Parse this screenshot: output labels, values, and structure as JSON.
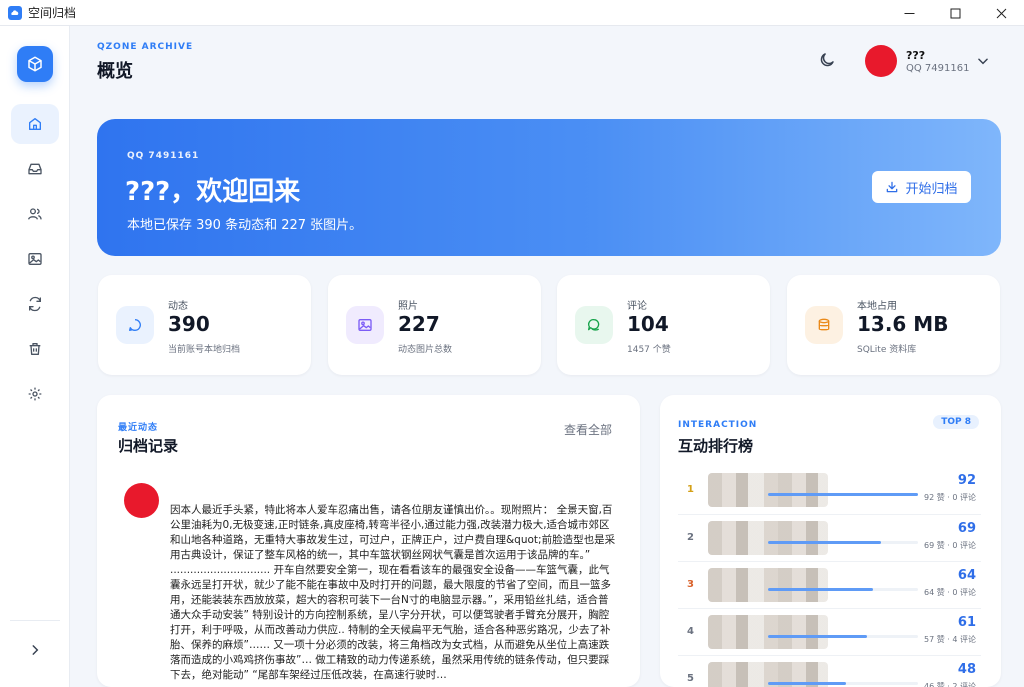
{
  "window": {
    "title": "空间归档"
  },
  "header": {
    "eyebrow": "QZONE ARCHIVE",
    "title": "概览",
    "user_name": "???",
    "user_id": "QQ 7491161"
  },
  "hero": {
    "account": "QQ 7491161",
    "greeting": "???，欢迎回来",
    "summary": "本地已保存 390 条动态和 227 张图片。",
    "button": "开始归档"
  },
  "stats": [
    {
      "label": "动态",
      "value": "390",
      "note": "当前账号本地归档",
      "icon": "chat-bubble-icon",
      "color": "#2f7df6",
      "bg": "#eaf2fe"
    },
    {
      "label": "照片",
      "value": "227",
      "note": "动态图片总数",
      "icon": "photo-icon",
      "color": "#7c5cf6",
      "bg": "#f0ebfe"
    },
    {
      "label": "评论",
      "value": "104",
      "note": "1457 个赞",
      "icon": "comment-icon",
      "color": "#16a34a",
      "bg": "#e8f7ee"
    },
    {
      "label": "本地占用",
      "value": "13.6 MB",
      "note": "SQLite 资料库",
      "icon": "database-icon",
      "color": "#ea8a1a",
      "bg": "#fdf1e2"
    }
  ],
  "archive": {
    "eyebrow": "最近动态",
    "title": "归档记录",
    "view_all": "查看全部",
    "post_text": "因本人最近手头紧，特此将本人爱车忍痛出售，请各位朋友谨慎出价。。现附照片： 全景天窗,百公里油耗为0,无极变速,正时链条,真皮座椅,转弯半径小,通过能力强,改装潜力极大,适合城市郊区和山地各种道路，无重特大事故发生过，可过户，正牌正户，过户费自理&quot;前脸造型也是采用古典设计，保证了整车风格的统一，其中车篮状钢丝网状气囊是首次运用于该品牌的车。” .............................. 开车自然要安全第一，现在看看该车的最强安全设备——车篮气囊，此气囊永远呈打开状，就少了能不能在事故中及时打开的问题，最大限度的节省了空间，而且一篮多用，还能装装东西放放菜，超大的容积可装下一台N寸的电脑显示器。”，采用铅丝扎结，适合普通大众手动安装” 特别设计的方向控制系统，呈八字分开状，可以便驾驶者手臂充分展开，胸腔打开，利于呼吸，从而改善动力供应.. 特制的全天候扁平无气胎，适合各种恶劣路况，少去了补胎、保养的麻烦”…… 又一项十分必须的改装，将三角档改为女式档，从而避免从坐位上高速跌落而造成的小鸡鸡挤伤事故”… 做工精致的动力传递系统，虽然采用传统的链条传动，但只要踩下去，绝对能动” “尾部车架经过压低改装，在高速行驶时…"
  },
  "ranking": {
    "eyebrow": "INTERACTION",
    "title": "互动排行榜",
    "badge": "TOP 8",
    "rows": [
      {
        "rank": "1",
        "score": "92",
        "detail": "92 赞 · 0 评论",
        "ratio": 1.0,
        "rank_color": "#d4a017"
      },
      {
        "rank": "2",
        "score": "69",
        "detail": "69 赞 · 0 评论",
        "ratio": 0.75,
        "rank_color": "#6b7280"
      },
      {
        "rank": "3",
        "score": "64",
        "detail": "64 赞 · 0 评论",
        "ratio": 0.7,
        "rank_color": "#d9622b"
      },
      {
        "rank": "4",
        "score": "61",
        "detail": "57 赞 · 4 评论",
        "ratio": 0.66,
        "rank_color": "#6b7280"
      },
      {
        "rank": "5",
        "score": "48",
        "detail": "46 赞 · 2 评论",
        "ratio": 0.52,
        "rank_color": "#6b7280"
      }
    ]
  }
}
